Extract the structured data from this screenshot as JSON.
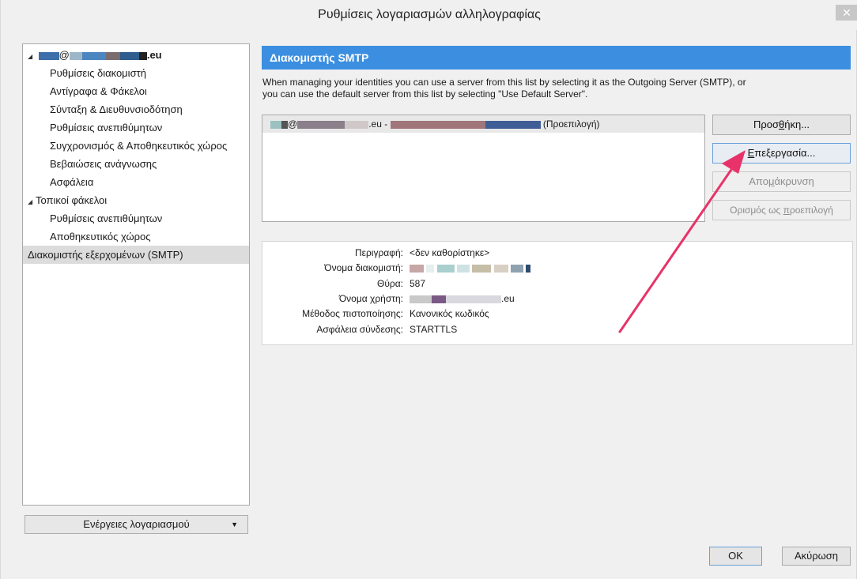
{
  "window": {
    "title": "Ρυθμίσεις λογαριασμών αλληλογραφίας",
    "close_glyph": "✕"
  },
  "tree": {
    "account_suffix": ".eu",
    "account_at": "@",
    "account_items": [
      "Ρυθμίσεις διακομιστή",
      "Αντίγραφα & Φάκελοι",
      "Σύνταξη & Διευθυνσιοδότηση",
      "Ρυθμίσεις ανεπιθύμητων",
      "Συγχρονισμός & Αποθηκευτικός χώρος",
      "Βεβαιώσεις ανάγνωσης",
      "Ασφάλεια"
    ],
    "local_folders": "Τοπικοί φάκελοι",
    "local_items": [
      "Ρυθμίσεις ανεπιθύμητων",
      "Αποθηκευτικός χώρος"
    ],
    "smtp_item": "Διακομιστής εξερχομένων (SMTP)"
  },
  "account_actions": {
    "label": "Ενέργειες λογαριασμού",
    "caret": "▼"
  },
  "panel": {
    "header": "Διακομιστής SMTP",
    "description_line1": "When managing your identities you can use a server from this list by selecting it as the Outgoing Server (SMTP), or",
    "description_line2": "you can use the default server from this list by selecting \"Use Default Server\".",
    "server_entry_mid": ".eu - ",
    "server_entry_at": "@",
    "server_entry_default": "(Προεπιλογή)"
  },
  "buttons": {
    "add_prefix": "Προσ",
    "add_key": "θ",
    "add_suffix": "ήκη...",
    "edit_key": "Ε",
    "edit_suffix": "πεξεργασία...",
    "remove_prefix": "Απο",
    "remove_key": "μ",
    "remove_suffix": "άκρυνση",
    "default_prefix": "Ορισμός ως ",
    "default_key": "π",
    "default_suffix": "ροεπιλογή",
    "ok": "OK",
    "cancel": "Ακύρωση"
  },
  "details": {
    "description_label": "Περιγραφή:",
    "description_value": "<δεν καθορίστηκε>",
    "server_name_label": "Όνομα διακομιστή:",
    "port_label": "Θύρα:",
    "port_value": "587",
    "username_label": "Όνομα χρήστη:",
    "username_value_suffix": ".eu",
    "auth_label": "Μέθοδος πιστοποίησης:",
    "auth_value": "Κανονικός κωδικός",
    "security_label": "Ασφάλεια σύνδεσης:",
    "security_value": "STARTTLS"
  },
  "colors": {
    "header_blue": "#3c8fe0",
    "arrow_pink": "#e8336a",
    "selection_gray": "#dcdcdc"
  }
}
